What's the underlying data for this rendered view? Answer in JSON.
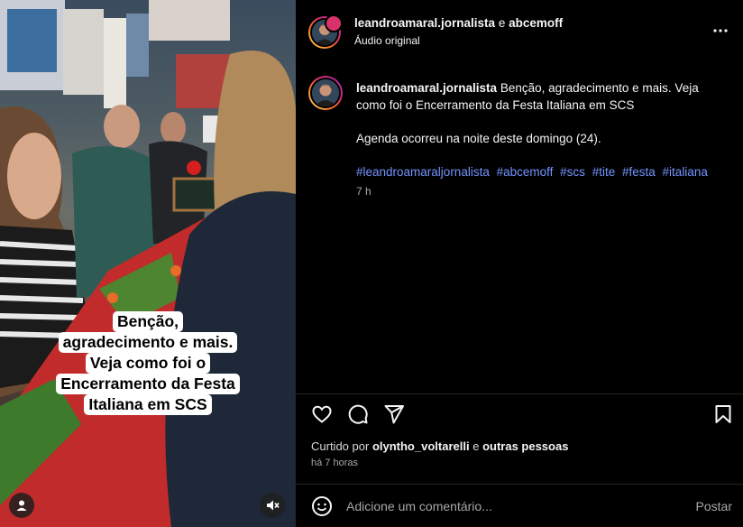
{
  "post": {
    "author": "leandroamaral.jornalista",
    "conjunction": "e",
    "coauthor": "abcemoff",
    "audio": "Áudio original"
  },
  "video": {
    "caption_lines": [
      "Benção,",
      "agradecimento e mais.",
      "Veja como foi o",
      "Encerramento da Festa",
      "Italiana em SCS"
    ],
    "user_icon": "user-icon",
    "mute_icon": "muted-speaker-icon"
  },
  "comment": {
    "username": "leandroamaral.jornalista",
    "text": "Benção, agradecimento e mais. Veja como foi o Encerramento da Festa Italiana em SCS",
    "text2": "Agenda ocorreu na noite deste domingo (24).",
    "hashtags": [
      "#leandroamaraljornalista",
      "#abcemoff",
      "#scs",
      "#tite",
      "#festa",
      "#italiana"
    ],
    "time": "7 h"
  },
  "actions": {
    "like_icon": "heart-icon",
    "comment_icon": "comment-icon",
    "share_icon": "share-icon",
    "save_icon": "bookmark-icon"
  },
  "likes": {
    "prefix": "Curtido por",
    "user": "olyntho_voltarelli",
    "conjunction": "e",
    "others": "outras pessoas"
  },
  "time_ago": "há 7 horas",
  "add_comment": {
    "placeholder": "Adicione um comentário...",
    "post_label": "Postar"
  },
  "colors": {
    "background": "#000000",
    "hashtag": "#7494ff",
    "muted_text": "#a8a8a8",
    "divider": "#262626"
  }
}
